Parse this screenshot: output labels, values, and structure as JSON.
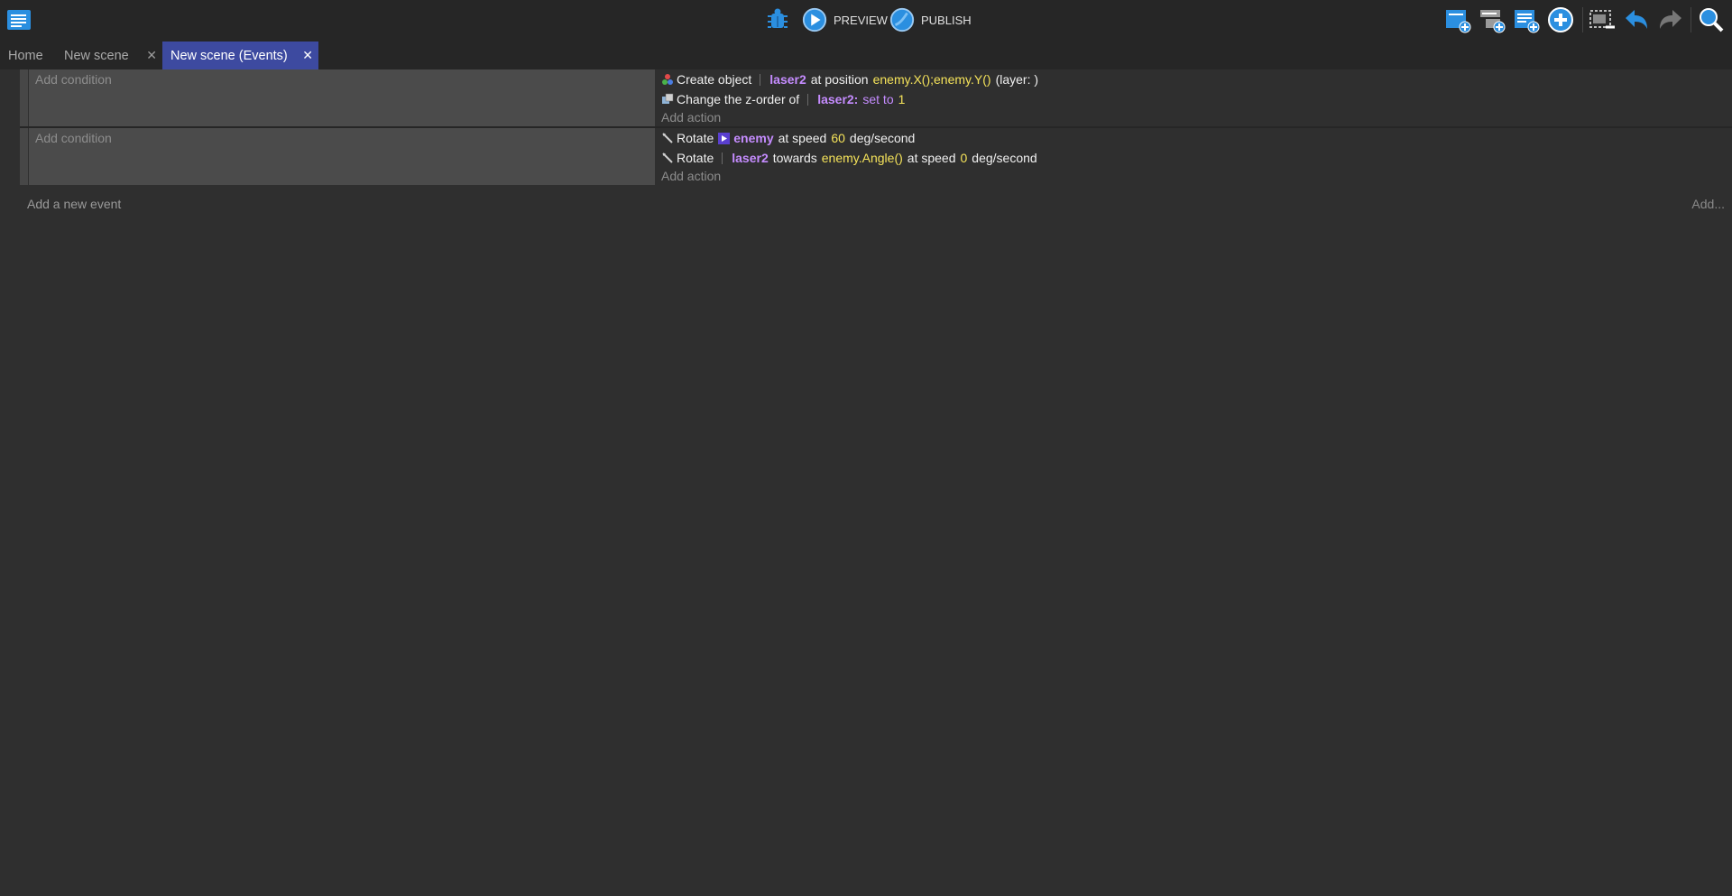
{
  "toolbar": {
    "preview_label": "PREVIEW",
    "publish_label": "PUBLISH"
  },
  "tabs": [
    {
      "label": "Home",
      "closable": false,
      "active": false
    },
    {
      "label": "New scene",
      "closable": true,
      "active": false
    },
    {
      "label": "New scene (Events)",
      "closable": true,
      "active": true
    }
  ],
  "tab_close_glyph": "✕",
  "events": [
    {
      "add_condition": "Add condition",
      "actions": [
        {
          "icon": "create-object-icon",
          "parts": {
            "verb": "Create object",
            "object": "laser2",
            "t1": "at position",
            "expr": "enemy.X();enemy.Y()",
            "t2": "(layer: )"
          }
        },
        {
          "icon": "z-order-icon",
          "parts": {
            "verb": "Change the z-order of",
            "object": "laser2:",
            "kw": "set to",
            "value": "1"
          }
        }
      ],
      "add_action": "Add action"
    },
    {
      "add_condition": "Add condition",
      "actions": [
        {
          "icon": "rotate-icon",
          "parts": {
            "verb": "Rotate",
            "object": "enemy",
            "t1": "at speed",
            "value": "60",
            "t2": "deg/second"
          }
        },
        {
          "icon": "rotate-icon",
          "parts": {
            "verb": "Rotate",
            "object": "laser2",
            "t1": "towards",
            "expr": "enemy.Angle()",
            "t2": "at speed",
            "value": "0",
            "t3": "deg/second"
          }
        }
      ],
      "add_action": "Add action"
    }
  ],
  "add_event_label": "Add a new event",
  "add_more_label": "Add...",
  "colors": {
    "background": "#2f2f2f",
    "toolbar": "#262626",
    "active_tab": "#3d4aa0",
    "object_name": "#c58cff",
    "expression": "#f5e35a",
    "icon_blue": "#2b8fe0"
  }
}
